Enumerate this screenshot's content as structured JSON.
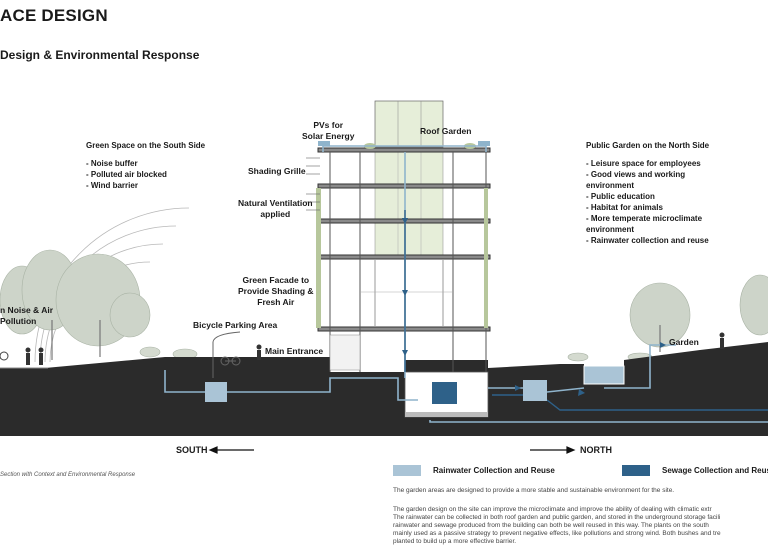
{
  "header": {
    "title": "ACE DESIGN",
    "subtitle": "Design & Environmental Response"
  },
  "labels": {
    "pvs": "PVs for\nSolar Energy",
    "roof_garden": "Roof Garden",
    "shading_grille": "Shading Grille",
    "natural_ventilation": "Natural Ventilation\napplied",
    "green_facade": "Green Facade to\nProvide Shading &\nFresh Air",
    "bicycle_parking": "Bicycle Parking Area",
    "main_entrance": "Main Entrance",
    "garden": "Garden",
    "noise_air": "n Noise & Air\nPollution"
  },
  "south_side": {
    "heading": "Green Space on the South Side",
    "items": [
      "- Noise buffer",
      "- Polluted air blocked",
      "- Wind barrier"
    ]
  },
  "north_side": {
    "heading": "Public Garden on the North Side",
    "items": [
      "- Leisure space for employees",
      "- Good views and working",
      "environment",
      "- Public education",
      "- Habitat for animals",
      "- More temperate microclimate",
      "environment",
      "- Rainwater collection and reuse"
    ]
  },
  "compass": {
    "south": "SOUTH",
    "north": "NORTH"
  },
  "caption": "Section with Context and Environmental Response",
  "legend": [
    {
      "label": "Rainwater Collection and Reuse",
      "color": "#aac4d6"
    },
    {
      "label": "Sewage Collection and Reuse",
      "color": "#2e6189"
    }
  ],
  "description": {
    "line1": "The garden areas are designed to provide a more stable and sustainable environment for the site.",
    "lines": [
      "The garden design on the site can improve the microclimate and improve the ability of dealing with climatic extr",
      "The rainwater can be collected in both roof garden and public garden, and stored in the underground storage facili",
      "rainwater and sewage produced from the building can both be well reused in this way. The plants on the south",
      "mainly used as a passive strategy to prevent negative effects, like pollutions and strong wind. Both bushes and tre",
      "planted to build up a more effective barrier."
    ]
  },
  "colors": {
    "ground": "#2b2b2b",
    "rain_pipe": "#8fb4cc",
    "sewage_pipe": "#2e6189",
    "glass": "#e6eed9",
    "tree": "#c9cfc6"
  }
}
